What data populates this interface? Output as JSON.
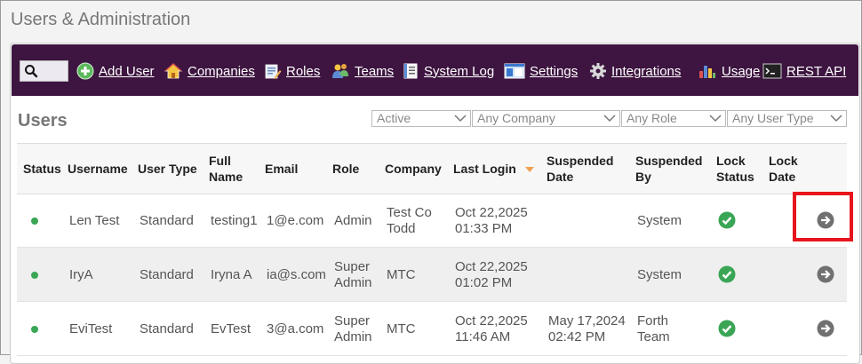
{
  "page": {
    "title": "Users & Administration"
  },
  "toolbar": {
    "search": {
      "value": "",
      "placeholder": ""
    },
    "items": [
      {
        "label": "Add User",
        "icon": "add-icon"
      },
      {
        "label": "Companies",
        "icon": "home-icon"
      },
      {
        "label": "Roles",
        "icon": "roles-icon"
      },
      {
        "label": "Teams",
        "icon": "teams-icon"
      },
      {
        "label": "System Log",
        "icon": "log-icon"
      },
      {
        "label": "Settings",
        "icon": "settings-icon"
      },
      {
        "label": "Integrations",
        "icon": "gear-icon"
      },
      {
        "label": "Usage",
        "icon": "bar-chart-icon"
      },
      {
        "label": "REST API",
        "icon": "terminal-icon"
      }
    ]
  },
  "users": {
    "title": "Users",
    "filters": {
      "status": "Active",
      "company": "Any Company",
      "role": "Any Role",
      "user_type": "Any User Type"
    },
    "columns": {
      "status": "Status",
      "username": "Username",
      "user_type": "User Type",
      "full_name_1": "Full",
      "full_name_2": "Name",
      "email": "Email",
      "role": "Role",
      "company": "Company",
      "last_login": "Last Login",
      "suspended_date_1": "Suspended",
      "suspended_date_2": "Date",
      "suspended_by_1": "Suspended",
      "suspended_by_2": "By",
      "lock_status_1": "Lock",
      "lock_status_2": "Status",
      "lock_date_1": "Lock",
      "lock_date_2": "Date"
    },
    "rows": [
      {
        "username": "Len Test",
        "user_type": "Standard",
        "full_name": "testing1",
        "email": "1@e.com",
        "role_1": "Admin",
        "role_2": "",
        "company_1": "Test Co",
        "company_2": "Todd",
        "last_login_1": "Oct 22,2025",
        "last_login_2": "01:33 PM",
        "suspended_date_1": "",
        "suspended_date_2": "",
        "suspended_by_1": "System",
        "suspended_by_2": ""
      },
      {
        "username": "IryA",
        "user_type": "Standard",
        "full_name": "Iryna A",
        "email": "ia@s.com",
        "role_1": "Super",
        "role_2": "Admin",
        "company_1": "MTC",
        "company_2": "",
        "last_login_1": "Oct 22,2025",
        "last_login_2": "01:02 PM",
        "suspended_date_1": "",
        "suspended_date_2": "",
        "suspended_by_1": "System",
        "suspended_by_2": ""
      },
      {
        "username": "EviTest",
        "user_type": "Standard",
        "full_name": "EvTest",
        "email": "3@a.com",
        "role_1": "Super",
        "role_2": "Admin",
        "company_1": "MTC",
        "company_2": "",
        "last_login_1": "Oct 22,2025",
        "last_login_2": "11:46 AM",
        "suspended_date_1": "May 17,2024",
        "suspended_date_2": "02:42 PM",
        "suspended_by_1": "Forth",
        "suspended_by_2": "Team"
      }
    ]
  },
  "colors": {
    "toolbar_bg": "#3d1540",
    "status_active": "#3aa655",
    "highlight": "#e8141b",
    "sort_arrow": "#f0a050"
  }
}
